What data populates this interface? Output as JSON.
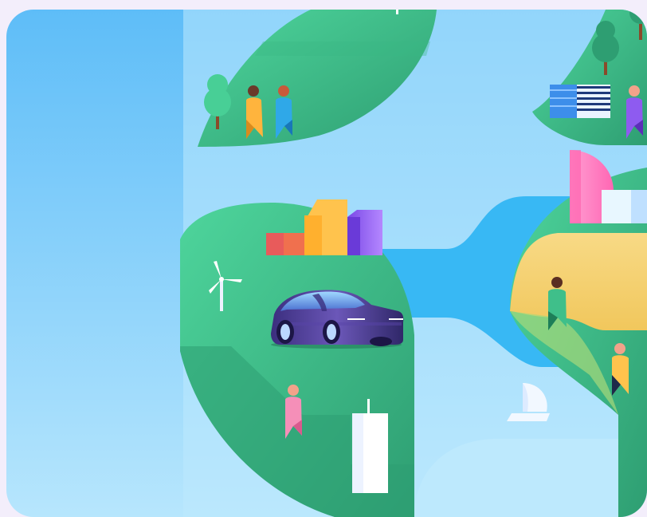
{
  "scene": {
    "kind": "isometric-island-illustration",
    "palette": {
      "frame": "#F3EEFB",
      "sky_top": "#5EBDF8",
      "sky_bottom": "#B7E6FD",
      "water": "#38B8F4",
      "land_light": "#48CF96",
      "land_dark": "#2E9E72",
      "sand": "#F5D27A",
      "car": "#3A2F7A",
      "building_yellow": "#FFC34D",
      "building_orange": "#F0704E",
      "building_purple": "#8E5BF0",
      "building_pink": "#FF7FC0"
    },
    "icons": {
      "wind_turbines": [
        "wind-turbine-icon",
        "wind-turbine-icon"
      ],
      "trees": [
        "tree-icon",
        "tree-icon",
        "tree-icon"
      ],
      "people": [
        "person-icon",
        "person-icon",
        "person-icon",
        "person-icon",
        "person-icon",
        "person-icon"
      ],
      "vehicle": "electric-car-icon",
      "boat": "sailboat-icon"
    }
  }
}
